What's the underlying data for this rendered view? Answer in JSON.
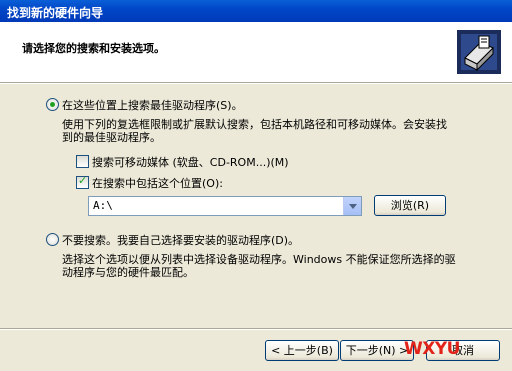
{
  "window": {
    "title": "找到新的硬件向导"
  },
  "header": {
    "title": "请选择您的搜索和安装选项。",
    "icon": "hardware-wizard-icon"
  },
  "search_option": {
    "label": "在这些位置上搜索最佳驱动程序(S)。",
    "selected": true,
    "description_line1": "使用下列的复选框限制或扩展默认搜索，包括本机路径和可移动媒体。会安装找",
    "description_line2": "到的最佳驱动程序。",
    "removable_media": {
      "label": "搜索可移动媒体 (软盘、CD-ROM...)(M)",
      "checked": false
    },
    "include_location": {
      "label": "在搜索中包括这个位置(O):",
      "checked": true
    },
    "location_value": "A:\\",
    "browse_label": "浏览(R)"
  },
  "manual_option": {
    "label": "不要搜索。我要自己选择要安装的驱动程序(D)。",
    "selected": false,
    "description_line1": "选择这个选项以便从列表中选择设备驱动程序。Windows 不能保证您所选择的驱",
    "description_line2": "动程序与您的硬件最匹配。"
  },
  "footer": {
    "back_label": "< 上一步(B)",
    "next_label": "下一步(N) >",
    "cancel_label": "取消"
  },
  "watermark": "WXYU",
  "colors": {
    "titlebar": "#0047c8",
    "dialog": "#ece9d8",
    "watermark": "#e2231a"
  }
}
